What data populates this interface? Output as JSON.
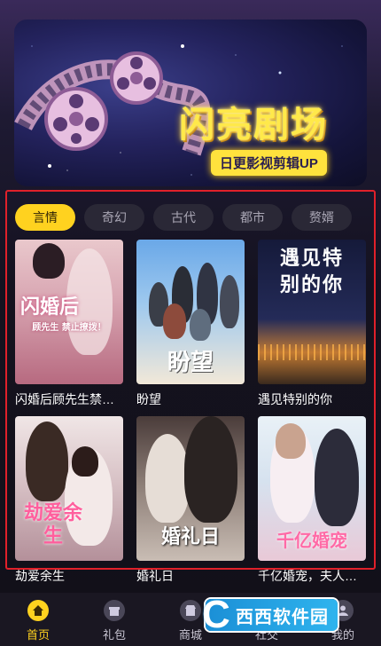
{
  "banner": {
    "title": "闪亮剧场",
    "subtitle": "日更影视剪辑UP"
  },
  "categories": {
    "items": [
      "言情",
      "奇幻",
      "古代",
      "都市",
      "赘婿"
    ],
    "active": "言情"
  },
  "dramas": [
    {
      "title": "闪婚后顾先生禁…",
      "poster_text": "闪婚后",
      "poster_sub": "顾先生 禁止撩拨！"
    },
    {
      "title": "盼望",
      "poster_text": "盼望"
    },
    {
      "title": "遇见特别的你",
      "poster_text": "遇见特别的你"
    },
    {
      "title": "劫爱余生",
      "poster_text": "劫爱余生"
    },
    {
      "title": "婚礼日",
      "poster_text": "婚礼日"
    },
    {
      "title": "千亿婚宠，夫人…",
      "poster_text": "千亿婚宠"
    }
  ],
  "nav": {
    "items": [
      "首页",
      "礼包",
      "商城",
      "社交",
      "我的"
    ],
    "active": "首页"
  },
  "watermark": {
    "text": "西西软件园"
  },
  "colors": {
    "accent": "#ffd21f",
    "highlight_frame": "#e0202a",
    "background": "#14121f"
  }
}
